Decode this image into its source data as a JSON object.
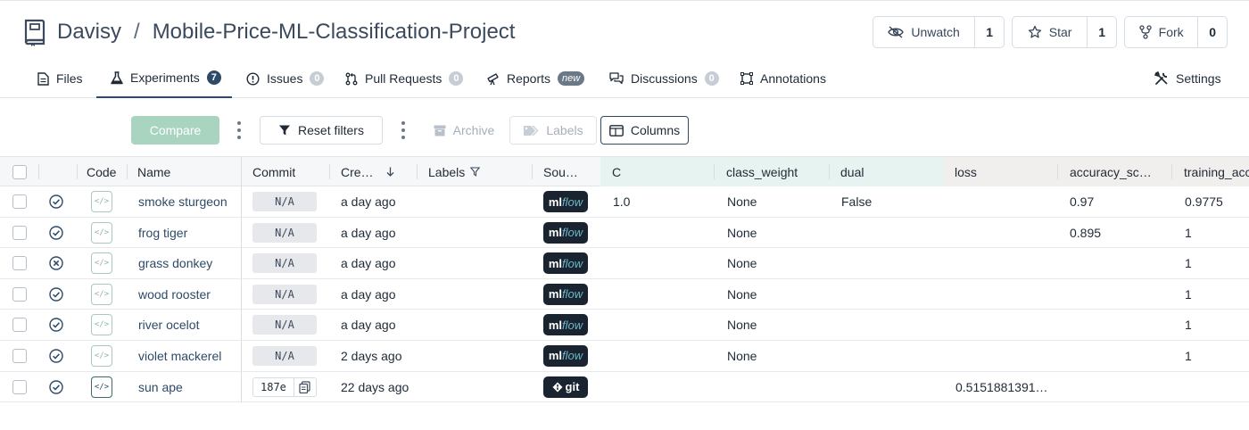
{
  "repo": {
    "owner": "Davisy",
    "separator": "/",
    "name": "Mobile-Price-ML-Classification-Project"
  },
  "actions": {
    "watch": {
      "label": "Unwatch",
      "count": "1"
    },
    "star": {
      "label": "Star",
      "count": "1"
    },
    "fork": {
      "label": "Fork",
      "count": "0"
    }
  },
  "tabs": [
    {
      "label": "Files",
      "icon": "file-icon"
    },
    {
      "label": "Experiments",
      "badge": "7",
      "icon": "flask-icon",
      "active": true
    },
    {
      "label": "Issues",
      "badge": "0",
      "icon": "alert-circle-icon"
    },
    {
      "label": "Pull Requests",
      "badge": "0",
      "icon": "pull-request-icon"
    },
    {
      "label": "Reports",
      "badge": "new",
      "icon": "telescope-icon"
    },
    {
      "label": "Discussions",
      "badge": "0",
      "icon": "chat-icon"
    },
    {
      "label": "Annotations",
      "icon": "square-icon"
    }
  ],
  "settings_label": "Settings",
  "toolbar": {
    "compare": "Compare",
    "reset_filters": "Reset filters",
    "archive": "Archive",
    "labels": "Labels",
    "columns": "Columns"
  },
  "columns": {
    "code": "Code",
    "name": "Name",
    "commit": "Commit",
    "created": "Cre…",
    "labels": "Labels",
    "source": "Sou…",
    "c": "C",
    "class_weight": "class_weight",
    "dual": "dual",
    "loss": "loss",
    "accuracy": "accuracy_sc…",
    "training": "training_acc"
  },
  "rows": [
    {
      "status": "success",
      "name": "smoke sturgeon",
      "commit": "N/A",
      "created": "a day ago",
      "source": "mlflow",
      "c": "1.0",
      "class_weight": "None",
      "dual": "False",
      "loss": "",
      "accuracy": "0.97",
      "training": "0.9775"
    },
    {
      "status": "success",
      "name": "frog tiger",
      "commit": "N/A",
      "created": "a day ago",
      "source": "mlflow",
      "c": "",
      "class_weight": "None",
      "dual": "",
      "loss": "",
      "accuracy": "0.895",
      "training": "1"
    },
    {
      "status": "failed",
      "name": "grass donkey",
      "commit": "N/A",
      "created": "a day ago",
      "source": "mlflow",
      "c": "",
      "class_weight": "None",
      "dual": "",
      "loss": "",
      "accuracy": "",
      "training": "1"
    },
    {
      "status": "success",
      "name": "wood rooster",
      "commit": "N/A",
      "created": "a day ago",
      "source": "mlflow",
      "c": "",
      "class_weight": "None",
      "dual": "",
      "loss": "",
      "accuracy": "",
      "training": "1"
    },
    {
      "status": "success",
      "name": "river ocelot",
      "commit": "N/A",
      "created": "a day ago",
      "source": "mlflow",
      "c": "",
      "class_weight": "None",
      "dual": "",
      "loss": "",
      "accuracy": "",
      "training": "1"
    },
    {
      "status": "success",
      "name": "violet mackerel",
      "commit": "N/A",
      "created": "2 days ago",
      "source": "mlflow",
      "c": "",
      "class_weight": "None",
      "dual": "",
      "loss": "",
      "accuracy": "",
      "training": "1"
    },
    {
      "status": "success",
      "name": "sun ape",
      "commit": "187e",
      "created": "22 days ago",
      "source": "git",
      "c": "",
      "class_weight": "",
      "dual": "",
      "loss": "0.5151881391…",
      "accuracy": "",
      "training": ""
    }
  ]
}
